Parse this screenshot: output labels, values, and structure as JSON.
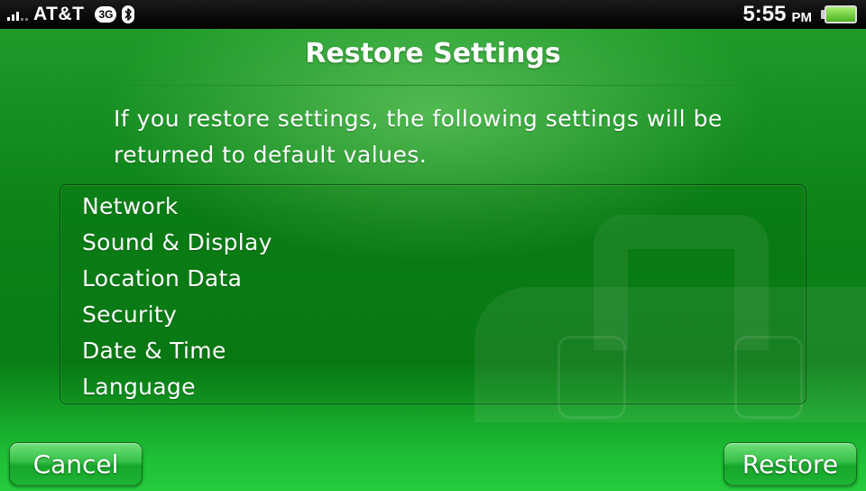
{
  "status_bar": {
    "carrier": "AT&T",
    "network_badge": "3G",
    "time": "5:55",
    "ampm": "PM",
    "icons": [
      "signal-icon",
      "bluetooth-icon",
      "battery-icon"
    ]
  },
  "dialog": {
    "title": "Restore Settings",
    "message": "If you restore settings, the following settings will be returned to default values.",
    "settings": [
      "Network",
      "Sound & Display",
      "Location Data",
      "Security",
      "Date & Time",
      "Language"
    ]
  },
  "buttons": {
    "cancel": "Cancel",
    "restore": "Restore"
  },
  "colors": {
    "accent": "#0c8218",
    "button": "#34c046"
  }
}
